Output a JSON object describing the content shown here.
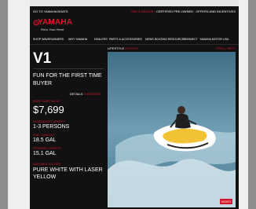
{
  "topbar": {
    "go_to": "GO TO YAMAHA BOATS",
    "find_dealer": "FIND A DEALER",
    "certified": "CERTIFIED PRE-OWNED",
    "offers": "OFFERS AND INCENTIVES"
  },
  "brand": {
    "logo_text": "YAMAHA",
    "tagline": "Revs Your Heart"
  },
  "nav": [
    "SHOP WAVERUNNERS",
    "WHY YAMAHA",
    "DEALERS",
    "PARTS & ACCESSORIES",
    "NEWS",
    "BOATING RESOURCES",
    "CONNECT",
    "YAMAHA MOTOR USA"
  ],
  "product": {
    "title": "V1",
    "tagline": "FUN FOR THE FIRST TIME BUYER",
    "details_label": "DETAILS",
    "details_link": "OVERVIEW",
    "specs": [
      {
        "label": "MSRP STARTING AT",
        "value": "$7,699"
      },
      {
        "label": "PASSENGER CAPACITY",
        "value": "1-3 PERSONS"
      },
      {
        "label": "FUEL CAPACITY",
        "value": "18.5 GAL"
      },
      {
        "label": "STORAGE CAPACITY",
        "value": "15.1 GAL"
      },
      {
        "label": "AVAILABLE COLORS",
        "value": "PURE WHITE WITH LASER YELLOW"
      }
    ]
  },
  "gallery": {
    "lifestyle": "LIFESTYLE",
    "photos": "PHOTOS",
    "prev": "PREV",
    "next": "NEXT",
    "video": "VIDEO"
  }
}
